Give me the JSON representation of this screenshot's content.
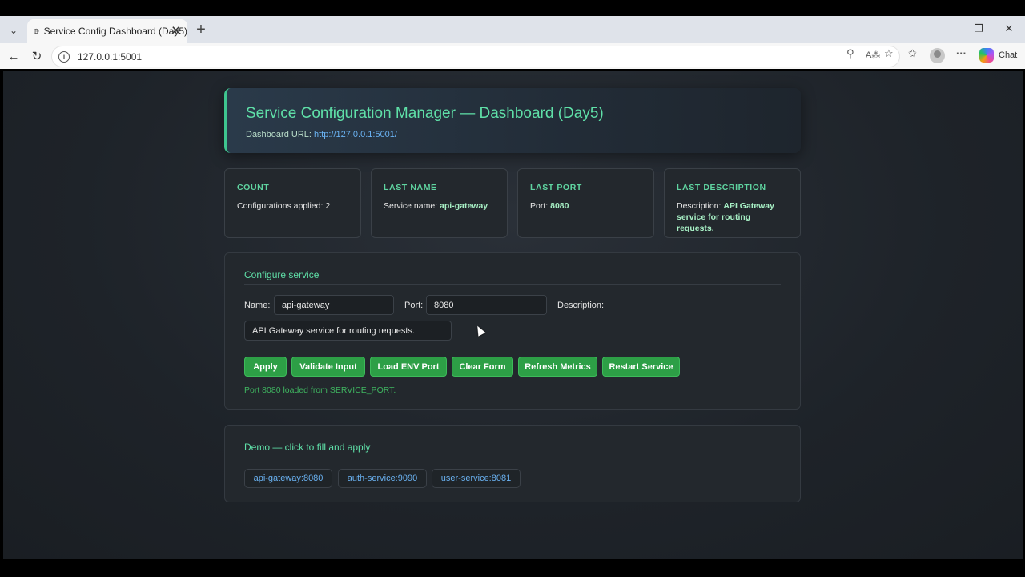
{
  "browser": {
    "tab_title": "Service Config Dashboard (Day5)",
    "url": "127.0.0.1:5001",
    "chat_label": "Chat"
  },
  "hero": {
    "title": "Service Configuration Manager — Dashboard (Day5)",
    "url_label": "Dashboard URL:",
    "url_link": "http://127.0.0.1:5001/"
  },
  "cards": [
    {
      "title": "COUNT",
      "label": "Configurations applied:",
      "value": "2"
    },
    {
      "title": "LAST NAME",
      "label": "Service name:",
      "value": "api-gateway"
    },
    {
      "title": "LAST PORT",
      "label": "Port:",
      "value": "8080"
    },
    {
      "title": "LAST DESCRIPTION",
      "label": "Description:",
      "value": "API Gateway service for routing requests."
    }
  ],
  "configure": {
    "title": "Configure service",
    "name_label": "Name:",
    "name_value": "api-gateway",
    "port_label": "Port:",
    "port_value": "8080",
    "desc_label": "Description:",
    "desc_value": "API Gateway service for routing requests.",
    "buttons": {
      "apply": "Apply",
      "validate": "Validate Input",
      "load_env": "Load ENV Port",
      "clear": "Clear Form",
      "refresh": "Refresh Metrics",
      "restart": "Restart Service"
    },
    "status": "Port 8080 loaded from SERVICE_PORT."
  },
  "demo": {
    "title": "Demo — click to fill and apply",
    "chips": [
      "api-gateway:8080",
      "auth-service:9090",
      "user-service:8081"
    ]
  },
  "colors": {
    "accent": "#5fe0a8",
    "button": "#2d9f46",
    "link": "#6ab2f2",
    "background": "#1e2329"
  }
}
